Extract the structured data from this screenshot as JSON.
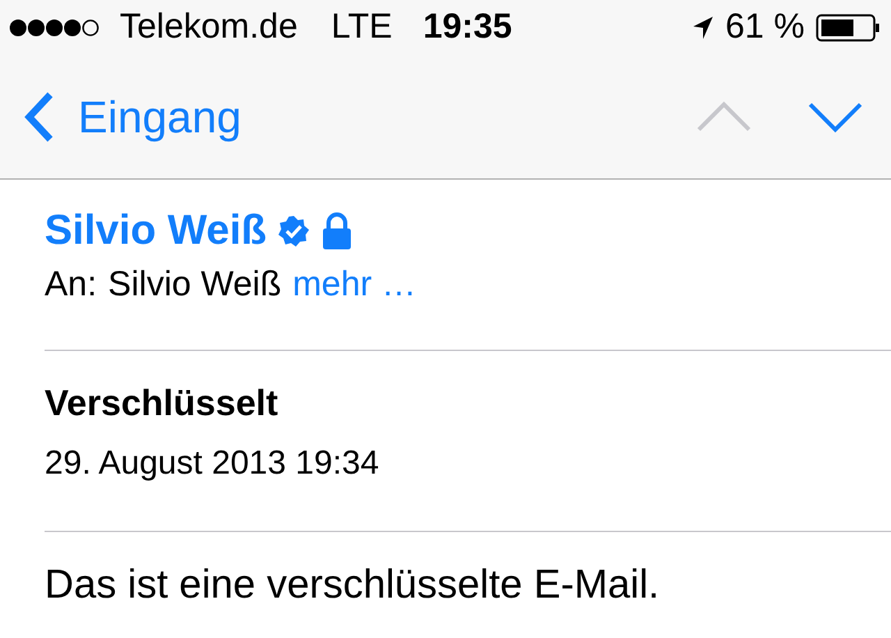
{
  "status_bar": {
    "carrier": "Telekom.de",
    "network": "LTE",
    "time": "19:35",
    "battery": "61 %"
  },
  "nav_bar": {
    "back_label": "Eingang",
    "buttons": [
      {
        "kind": "up",
        "disabled": true
      },
      {
        "kind": "down",
        "disabled": false
      }
    ]
  },
  "header": {
    "sender": "Silvio Weiß",
    "verified": true,
    "encrypted": true,
    "to_label": "An:",
    "to": "Silvio Weiß",
    "more": "mehr …"
  },
  "subject": "Verschlüsselt",
  "date": "29. August 2013 19:34",
  "body": "Das ist eine verschlüsselte E-Mail."
}
